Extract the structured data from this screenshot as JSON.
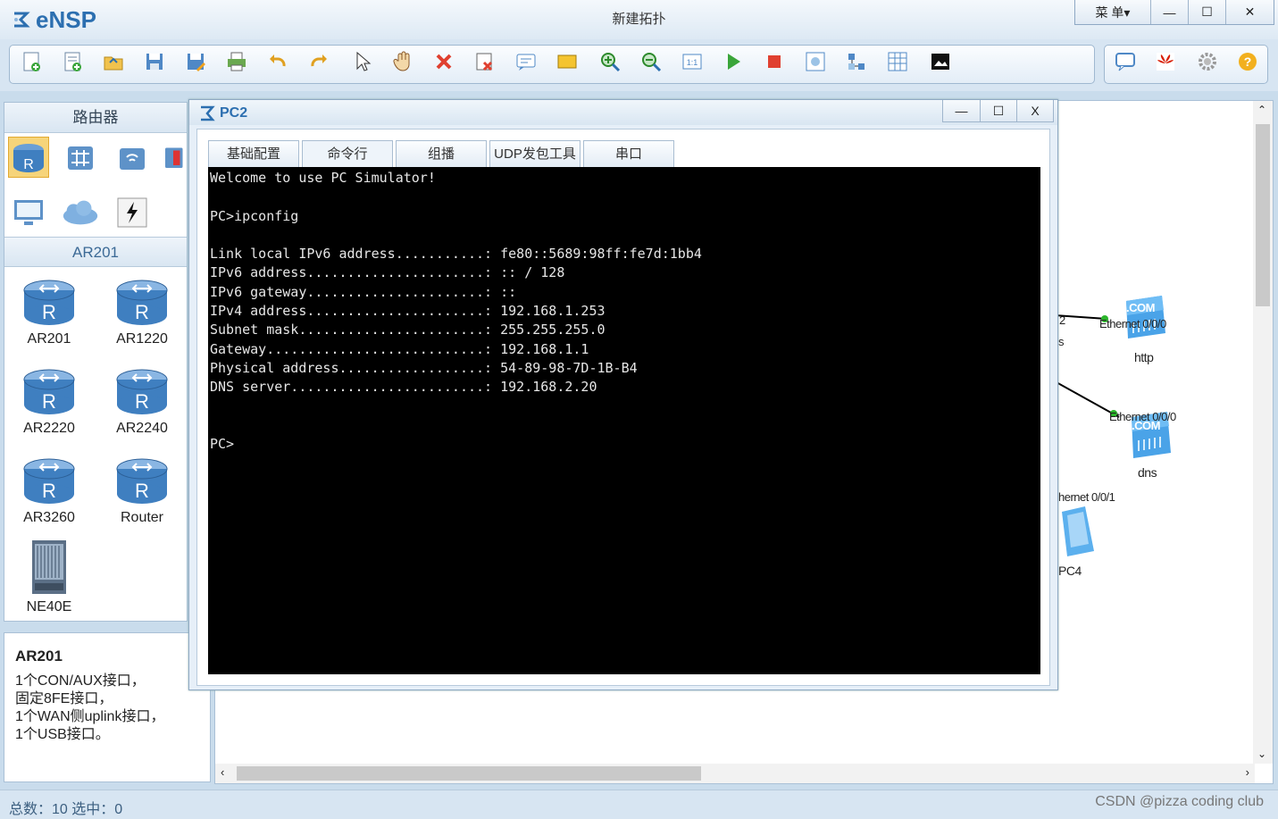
{
  "app": {
    "name": "eNSP",
    "title": "新建拓扑",
    "menu_label": "菜 单▾"
  },
  "window_controls": {
    "minimize": "—",
    "maximize": "☐",
    "close": "✕"
  },
  "toolbar": {
    "main": [
      "new-topology-icon",
      "new-example-icon",
      "open-icon",
      "save-icon",
      "save-as-icon",
      "print-icon",
      "undo-icon",
      "redo-icon",
      "select-icon",
      "pan-icon",
      "delete-icon",
      "delete-connection-icon",
      "text-icon",
      "rectangle-icon",
      "zoom-in-icon",
      "zoom-out-icon",
      "fit-icon",
      "start-icon",
      "stop-icon",
      "capture-icon",
      "topology-icon",
      "grid-icon",
      "screenshot-icon"
    ],
    "right": [
      "chat-icon",
      "huawei-icon",
      "settings-icon",
      "help-icon"
    ]
  },
  "sidebar": {
    "header": "路由器",
    "subheader": "AR201",
    "devices": [
      {
        "label": "AR201"
      },
      {
        "label": "AR1220"
      },
      {
        "label": "AR2220"
      },
      {
        "label": "AR2240"
      },
      {
        "label": "AR3260"
      },
      {
        "label": "Router"
      },
      {
        "label": "NE40E"
      }
    ]
  },
  "description": {
    "title": "AR201",
    "lines": [
      "1个CON/AUX接口，",
      "固定8FE接口，",
      "1个WAN侧uplink接口，",
      "1个USB接口。"
    ]
  },
  "canvas": {
    "labels": {
      "http_port": "Ethernet 0/0/0",
      "http_name": "http",
      "dns_port": "Ethernet 0/0/0",
      "dns_name": "dns",
      "pc4_port": "hernet 0/0/1",
      "pc4_name": "PC4",
      "partial_2": "2",
      "partial_s": "s",
      "com1": ".COM",
      "com2": ".COM"
    }
  },
  "pc2": {
    "title": "PC2",
    "controls": {
      "minimize": "—",
      "maximize": "☐",
      "close": "X"
    },
    "tabs": [
      "基础配置",
      "命令行",
      "组播",
      "UDP发包工具",
      "串口"
    ],
    "terminal": [
      "Welcome to use PC Simulator!",
      "",
      "PC>ipconfig",
      "",
      "Link local IPv6 address...........: fe80::5689:98ff:fe7d:1bb4",
      "IPv6 address......................: :: / 128",
      "IPv6 gateway......................: ::",
      "IPv4 address......................: 192.168.1.253",
      "Subnet mask.......................: 255.255.255.0",
      "Gateway...........................: 192.168.1.1",
      "Physical address..................: 54-89-98-7D-1B-B4",
      "DNS server........................: 192.168.2.20",
      "",
      "",
      "PC>"
    ]
  },
  "status": {
    "text": "总数：10  选中：0",
    "watermark": "CSDN @pizza coding club"
  },
  "colors": {
    "accent": "#2c6fb0",
    "router_blue": "#3f7fc0",
    "server_blue": "#4aa3e8",
    "terminal_bg": "#000000"
  }
}
